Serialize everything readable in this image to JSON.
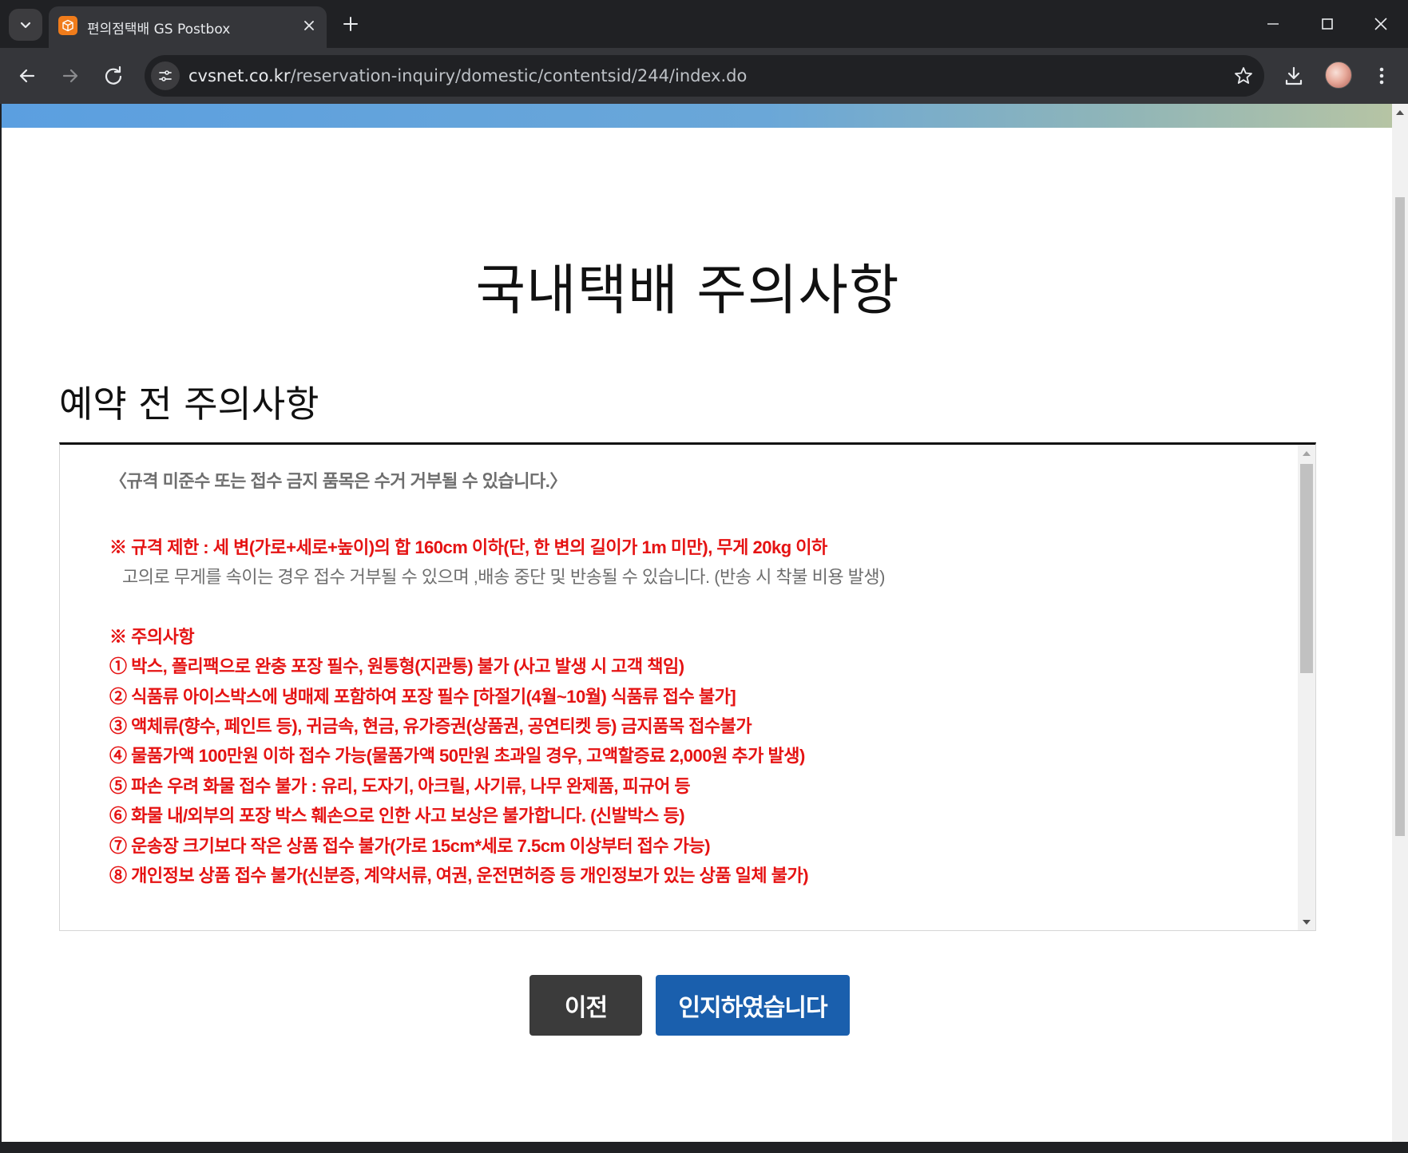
{
  "browser": {
    "tab_title": "편의점택배 GS Postbox",
    "url_host": "cvsnet.co.kr",
    "url_path": "/reservation-inquiry/domestic/contentsid/244/index.do"
  },
  "page": {
    "title": "국내택배 주의사항",
    "section_title": "예약 전 주의사항"
  },
  "notice": {
    "intro": "〈규격 미준수 또는 접수 금지 품목은 수거 거부될 수 있습니다.〉",
    "size_limit": "※ 규격 제한 : 세 변(가로+세로+높이)의 합 160cm 이하(단, 한 변의 길이가 1m 미만), 무게 20kg 이하",
    "size_limit_note": "고의로 무게를 속이는 경우 접수 거부될 수 있으며 ,배송 중단 및 반송될 수 있습니다. (반송 시 착불 비용 발생)",
    "cautions_heading": "※ 주의사항",
    "items": [
      "① 박스, 폴리팩으로 완충 포장 필수, 원통형(지관통) 불가 (사고 발생 시 고객 책임)",
      "② 식품류 아이스박스에 냉매제 포함하여 포장 필수 [하절기(4월~10월) 식품류 접수 불가]",
      "③ 액체류(향수, 페인트 등), 귀금속, 현금, 유가증권(상품권, 공연티켓 등) 금지품목 접수불가",
      "④ 물품가액 100만원 이하 접수 가능(물품가액 50만원 초과일 경우, 고액할증료 2,000원 추가 발생)",
      "⑤ 파손 우려 화물 접수 불가 : 유리, 도자기, 아크릴, 사기류, 나무 완제품, 피규어 등",
      "⑥ 화물 내/외부의 포장 박스 훼손으로 인한 사고 보상은 불가합니다. (신발박스 등)",
      "⑦ 운송장 크기보다 작은 상품 접수 불가(가로 15cm*세로 7.5cm 이상부터 접수 가능)",
      "⑧ 개인정보 상품 접수 불가(신분증, 계약서류, 여권, 운전면허증 등 개인정보가 있는 상품 일체 불가)"
    ]
  },
  "buttons": {
    "prev": "이전",
    "acknowledge": "인지하였습니다"
  },
  "colors": {
    "accent_blue": "#1a5fad",
    "dark_button": "#3b3b3b",
    "warning_red": "#e51313",
    "favicon_orange": "#f07c1b"
  },
  "icons": {
    "tab_search": "chevron-down-icon",
    "favicon": "package-icon",
    "tab_close": "close-icon",
    "new_tab": "plus-icon",
    "back": "arrow-left-icon",
    "forward": "arrow-right-icon",
    "reload": "reload-icon",
    "site_info": "tune-icon",
    "bookmark": "star-icon",
    "download": "download-icon",
    "menu": "kebab-menu-icon"
  }
}
